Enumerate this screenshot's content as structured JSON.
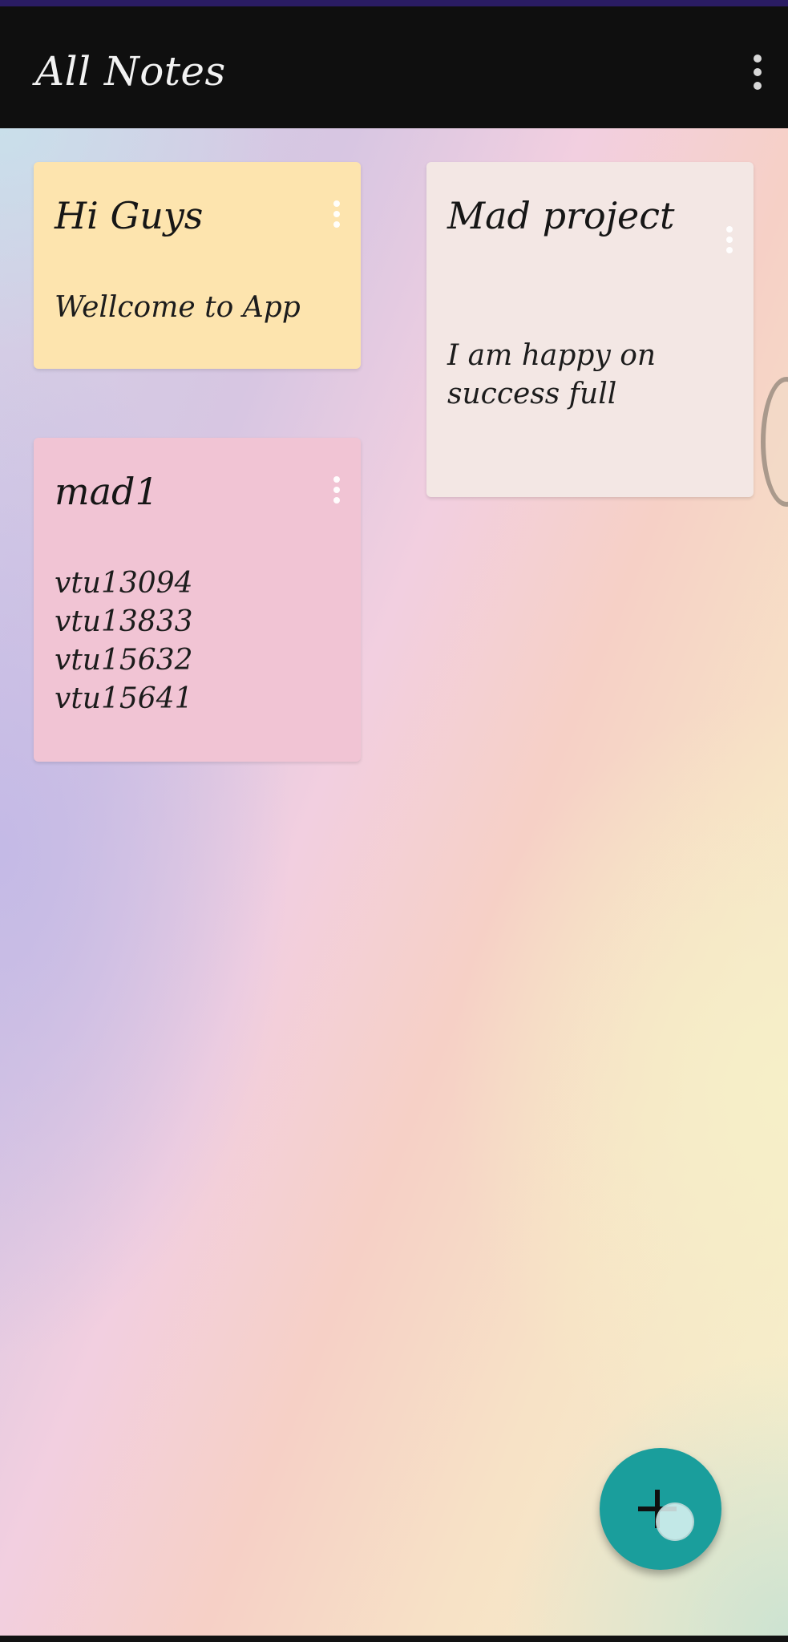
{
  "app_bar": {
    "title": "All Notes",
    "menu_icon": "more-vert-icon"
  },
  "notes": [
    {
      "title": "Hi Guys",
      "body": "Wellcome to App",
      "color": "#fde4ae",
      "menu_icon": "more-vert-icon"
    },
    {
      "title": "Mad project",
      "body": "I am happy on\nsuccess full",
      "color": "#f3e7e4",
      "menu_icon": "more-vert-icon"
    },
    {
      "title": "mad1",
      "body": "vtu13094\nvtu13833\nvtu15632\nvtu15641",
      "color": "#f1c4d4",
      "menu_icon": "more-vert-icon"
    }
  ],
  "fab": {
    "icon": "plus-icon",
    "color": "#1a9e9c"
  },
  "colors": {
    "app_bar": "#0f0f0f",
    "app_bar_text": "#f2f2f2",
    "status_strip": "#2a1c63"
  }
}
